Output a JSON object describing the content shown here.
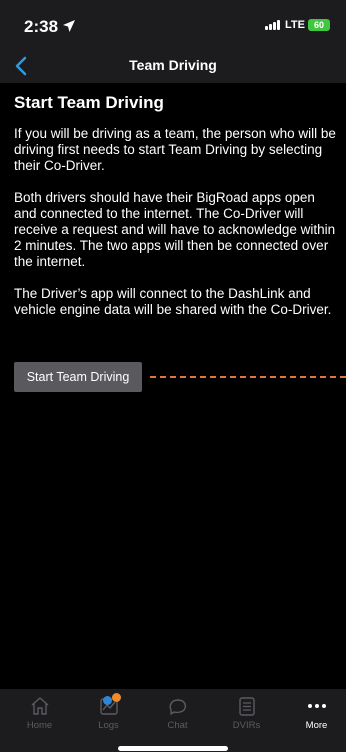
{
  "status_bar": {
    "time": "2:38",
    "network": "LTE",
    "battery": "60"
  },
  "nav": {
    "title": "Team Driving"
  },
  "main": {
    "heading": "Start Team Driving",
    "paragraphs": [
      "If you will be driving as a team, the person who will be driving first needs to start Team Driving by selecting their Co-Driver.",
      "Both drivers should have their BigRoad apps open and connected to the internet. The Co-Driver will receive a request and will have to acknowledge within 2 minutes. The two apps will then be connected over the internet.",
      "The Driver’s app will connect to the DashLink and vehicle engine data will be shared with the Co-Driver."
    ],
    "button_label": "Start Team Driving"
  },
  "tabs": [
    {
      "label": "Home",
      "icon": "home-icon",
      "active": false
    },
    {
      "label": "Logs",
      "icon": "logs-icon",
      "active": false
    },
    {
      "label": "Chat",
      "icon": "chat-icon",
      "active": false
    },
    {
      "label": "DVIRs",
      "icon": "dvirs-icon",
      "active": false
    },
    {
      "label": "More",
      "icon": "more-icon",
      "active": true
    }
  ],
  "colors": {
    "accent": "#2e9be0",
    "annotation": "#e2763a",
    "badge_blue": "#2e86d6",
    "badge_orange": "#f08a2a",
    "battery": "#3fc73f"
  }
}
